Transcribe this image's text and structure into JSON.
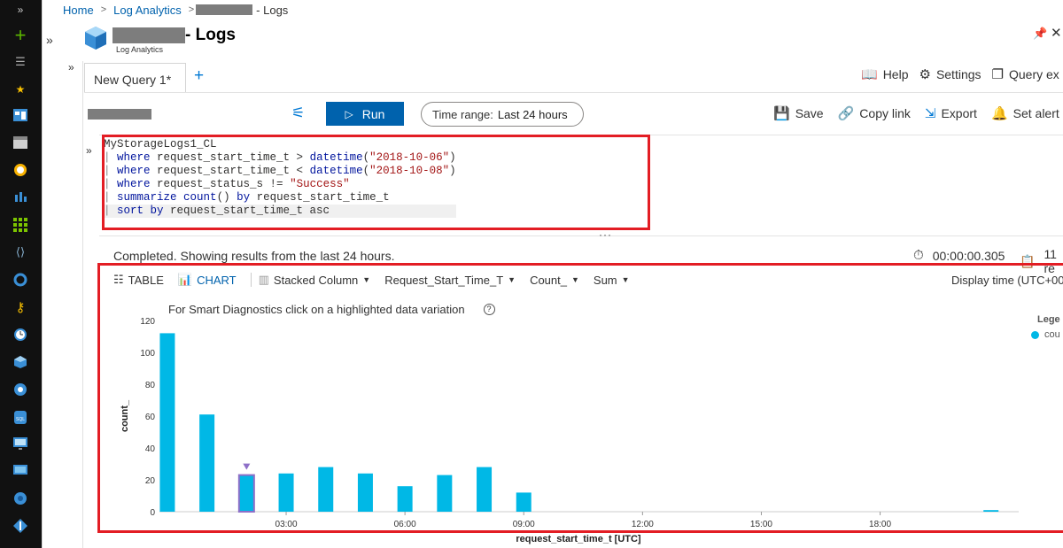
{
  "rail": {
    "icons": [
      "expand-icon",
      "create-resource-icon",
      "all-services-icon",
      "favorites-star-icon",
      "dashboard-icon",
      "all-resources-icon",
      "monitor-icon",
      "app-insights-icon",
      "apps-grid-icon",
      "network-icon",
      "devops-icon",
      "key-vault-icon",
      "clock-icon",
      "cube-icon",
      "globe-icon",
      "sql-icon",
      "monitor-screen-icon",
      "virtual-machine-icon",
      "gear-cloud-icon",
      "diamond-icon"
    ]
  },
  "breadcrumb": {
    "home": "Home",
    "log_analytics": "Log Analytics",
    "current": "- Logs"
  },
  "header": {
    "title_suffix": "- Logs",
    "subtitle": "Log Analytics"
  },
  "tabs": {
    "active": "New Query 1*",
    "add": "+"
  },
  "top_actions": {
    "help": "Help",
    "settings": "Settings",
    "query_explorer": "Query ex"
  },
  "toolbar": {
    "run": "Run",
    "time_range_label": "Time range:",
    "time_range_value": "Last 24 hours",
    "save": "Save",
    "copy_link": "Copy link",
    "export": "Export",
    "set_alert": "Set alert"
  },
  "query": {
    "table": "MyStorageLogs1_CL",
    "l1_kw": "where",
    "l1_col": " request_start_time_t > ",
    "l1_fn": "datetime",
    "l1_arg": "\"2018-10-06\"",
    "l2_kw": "where",
    "l2_col": " request_start_time_t < ",
    "l2_fn": "datetime",
    "l2_arg": "\"2018-10-08\"",
    "l3_kw": "where",
    "l3_col": " request_status_s != ",
    "l3_arg": "\"Success\"",
    "l4_kw": "summarize",
    "l4_fn": "count",
    "l4_rest": "() ",
    "l4_by": "by",
    "l4_col": " request_start_time_t",
    "l5_kw": "sort by",
    "l5_col": " request_start_time_t asc"
  },
  "status": {
    "message": "Completed. Showing results from the last 24 hours.",
    "elapsed": "00:00:00.305",
    "records": "11 re"
  },
  "results_toolbar": {
    "table": "TABLE",
    "chart": "CHART",
    "chart_type": "Stacked Column",
    "x_col": "Request_Start_Time_T",
    "y_col": "Count_",
    "agg": "Sum",
    "display_time": "Display time (UTC+00:"
  },
  "chart_note": "For Smart Diagnostics click on a highlighted data variation",
  "legend": {
    "title": "Lege",
    "item": "cou"
  },
  "colors": {
    "bar": "#00b8e6",
    "highlight": "#e31d24",
    "accent": "#0062ad",
    "anomaly": "#8e6fc8"
  },
  "chart_data": {
    "type": "bar",
    "title": "",
    "xlabel": "request_start_time_t [UTC]",
    "ylabel": "count_",
    "ylim": [
      0,
      120
    ],
    "yticks": [
      0,
      20,
      40,
      60,
      80,
      100,
      120
    ],
    "x_tick_labels": [
      "03:00",
      "06:00",
      "09:00",
      "12:00",
      "15:00",
      "18:00"
    ],
    "x_tick_hours": [
      3,
      6,
      9,
      12,
      15,
      18
    ],
    "x_range_hours": [
      -0.2,
      21.5
    ],
    "series": [
      {
        "name": "count_",
        "x_hours": [
          0,
          1,
          2,
          3,
          4,
          5,
          6,
          7,
          8,
          9,
          20.8
        ],
        "values": [
          112,
          61,
          23,
          24,
          28,
          24,
          16,
          23,
          28,
          12,
          1
        ],
        "anomaly_index": 2
      }
    ]
  }
}
